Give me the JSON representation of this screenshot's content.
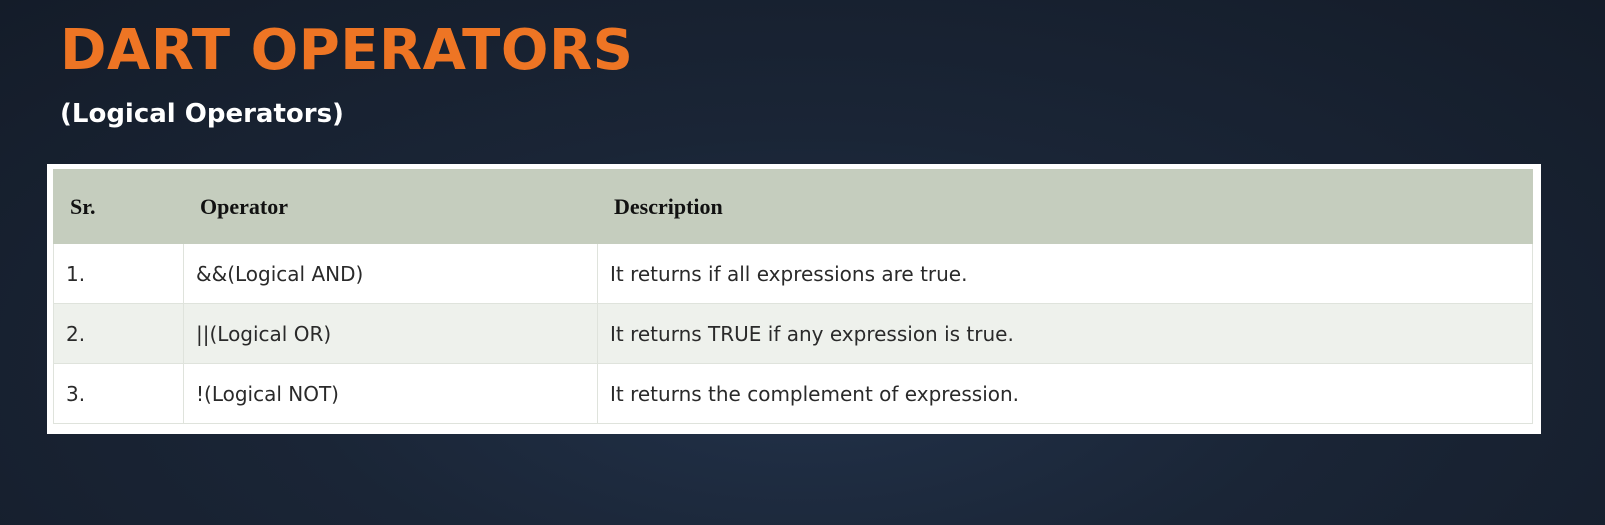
{
  "slide": {
    "title": "DART OPERATORS",
    "subtitle": "(Logical Operators)"
  },
  "table": {
    "headers": {
      "sr": "Sr.",
      "operator": "Operator",
      "description": "Description"
    },
    "rows": [
      {
        "sr": "1.",
        "operator": "&&(Logical AND)",
        "description": "It returns if all expressions are true."
      },
      {
        "sr": "2.",
        "operator": "||(Logical OR)",
        "description": "It returns TRUE if any expression is true."
      },
      {
        "sr": "3.",
        "operator": "!(Logical NOT)",
        "description": "It returns the complement of expression."
      }
    ]
  },
  "colors": {
    "title": "#ee7524",
    "subtitle": "#ffffff",
    "header_background": "#c5cdbe",
    "background": "#1a2536"
  }
}
